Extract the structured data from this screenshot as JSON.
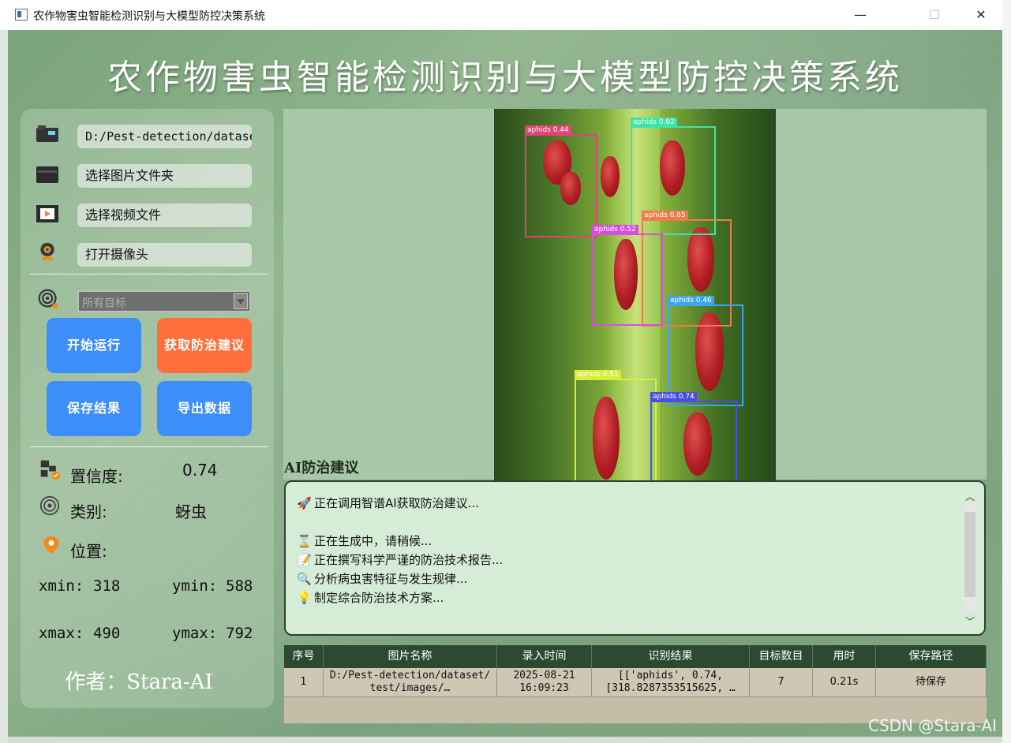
{
  "window": {
    "title": "农作物害虫智能检测识别与大模型防控决策系统",
    "minimize": "—",
    "maximize": "☐",
    "close": "✕"
  },
  "app_title": "农作物害虫智能检测识别与大模型防控决策系统",
  "sidebar": {
    "path_value": "D:/Pest-detection/dataset/test/images/",
    "select_folder": "选择图片文件夹",
    "select_video": "选择视频文件",
    "open_camera": "打开摄像头",
    "target_select": "所有目标",
    "buttons": {
      "start": "开始运行",
      "advice": "获取防治建议",
      "save": "保存结果",
      "export": "导出数据"
    },
    "confidence_label": "置信度:",
    "confidence_value": "0.74",
    "class_label": "类别:",
    "class_value": "蚜虫",
    "position_label": "位置:",
    "xmin_label": "xmin:",
    "xmin": "318",
    "ymin_label": "ymin:",
    "ymin": "588",
    "xmax_label": "xmax:",
    "xmax": "490",
    "ymax_label": "ymax:",
    "ymax": "792",
    "author": "作者：Stara-AI"
  },
  "detections": [
    {
      "label": "aphids 0.44",
      "color": "#e0457a"
    },
    {
      "label": "aphids 0.62",
      "color": "#3ee3a8"
    },
    {
      "label": "aphids 0.65",
      "color": "#ee7b4a"
    },
    {
      "label": "aphids 0.52",
      "color": "#d84fe0"
    },
    {
      "label": "aphids 0.46",
      "color": "#3fa4f0"
    },
    {
      "label": "aphids 0.51",
      "color": "#d7ee3a"
    },
    {
      "label": "aphids 0.74",
      "color": "#4a4de6"
    }
  ],
  "ai": {
    "heading": "AI防治建议",
    "lines": [
      {
        "icon": "🚀",
        "text": "正在调用智谱AI获取防治建议..."
      },
      {
        "icon": "",
        "text": ""
      },
      {
        "icon": "⌛",
        "text": "正在生成中，请稍候..."
      },
      {
        "icon": "📝",
        "text": "正在撰写科学严谨的防治技术报告..."
      },
      {
        "icon": "🔍",
        "text": "分析病虫害特征与发生规律..."
      },
      {
        "icon": "💡",
        "text": "制定综合防治技术方案..."
      }
    ]
  },
  "table": {
    "headers": [
      "序号",
      "图片名称",
      "录入时间",
      "识别结果",
      "目标数目",
      "用时",
      "保存路径"
    ],
    "rows": [
      [
        "1",
        "D:/Pest-detection/dataset/\ntest/images/…",
        "2025-08-21\n16:09:23",
        "[['aphids', 0.74,\n[318.8287353515625, …",
        "7",
        "0.21s",
        "待保存"
      ]
    ]
  },
  "watermark": "CSDN @Stara-AI"
}
